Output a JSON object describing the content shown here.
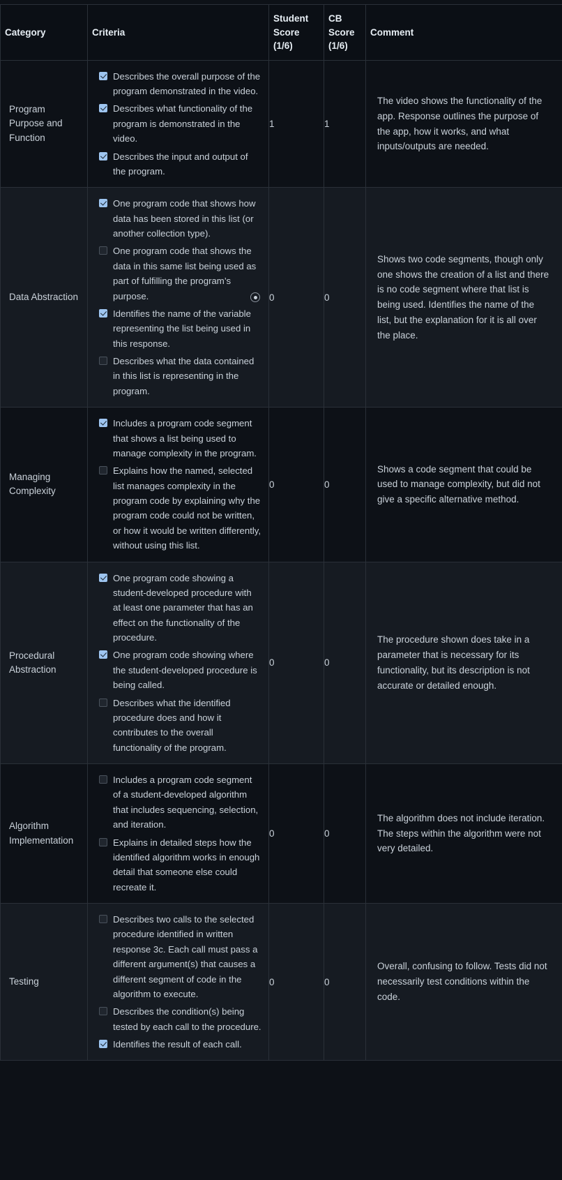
{
  "table": {
    "headers": {
      "category": "Category",
      "criteria": "Criteria",
      "student_score": "Student Score (1/6)",
      "student_score_line1": "Student",
      "student_score_line2": "Score",
      "student_score_line3": "(1/6)",
      "cb_score": "CB Score (1/6)",
      "cb_score_line1": "CB",
      "cb_score_line2": "Score",
      "cb_score_line3": "(1/6)",
      "comment": "Comment"
    },
    "rows": [
      {
        "category": "Program Purpose and Function",
        "criteria": [
          {
            "checked": true,
            "text": "Describes the overall purpose of the program demonstrated in the video."
          },
          {
            "checked": true,
            "text": "Describes what functionality of the program is demonstrated in the video."
          },
          {
            "checked": true,
            "text": "Describes the input and output of the program."
          }
        ],
        "student_score": "1",
        "cb_score": "1",
        "comment": "The video shows the functionality of the app. Response outlines the purpose of the app, how it works, and what inputs/outputs are needed.",
        "has_radio_marker": false
      },
      {
        "category": "Data Abstraction",
        "criteria": [
          {
            "checked": true,
            "text": "One program code that shows how data has been stored in this list (or another collection type)."
          },
          {
            "checked": false,
            "text": "One program code that shows the data in this same list being used as part of fulfilling the program’s purpose."
          },
          {
            "checked": true,
            "text": "Identifies the name of the variable representing the list being used in this response."
          },
          {
            "checked": false,
            "text": "Describes what the data contained in this list is representing in the program."
          }
        ],
        "student_score": "0",
        "cb_score": "0",
        "comment": "Shows two code segments, though only one shows the creation of a list and there is no code segment where that list is being used. Identifies the name of the list, but the explanation for it is all over the place.",
        "has_radio_marker": true
      },
      {
        "category": "Managing Complexity",
        "criteria": [
          {
            "checked": true,
            "text": "Includes a program code segment that shows a list being used to manage complexity in the program."
          },
          {
            "checked": false,
            "text": "Explains how the named, selected list manages complexity in the program code by explaining why the program code could not be written, or how it would be written differently, without using this list."
          }
        ],
        "student_score": "0",
        "cb_score": "0",
        "comment": "Shows a code segment that could be used to manage complexity, but did not give a specific alternative method.",
        "has_radio_marker": false
      },
      {
        "category": "Procedural Abstraction",
        "criteria": [
          {
            "checked": true,
            "text": "One program code showing a student-developed procedure with at least one parameter that has an effect on the functionality of the procedure."
          },
          {
            "checked": true,
            "text": "One program code showing where the student-developed procedure is being called."
          },
          {
            "checked": false,
            "text": "Describes what the identified procedure does and how it contributes to the overall functionality of the program."
          }
        ],
        "student_score": "0",
        "cb_score": "0",
        "comment": "The procedure shown does take in a parameter that is necessary for its functionality, but its description is not accurate or detailed enough.",
        "has_radio_marker": false
      },
      {
        "category": "Algorithm Implementation",
        "criteria": [
          {
            "checked": false,
            "text": "Includes a program code segment of a student-developed algorithm that includes sequencing, selection, and iteration."
          },
          {
            "checked": false,
            "text": "Explains in detailed steps how the identified algorithm works in enough detail that someone else could recreate it."
          }
        ],
        "student_score": "0",
        "cb_score": "0",
        "comment": "The algorithm does not include iteration. The steps within the algorithm were not very detailed.",
        "has_radio_marker": false
      },
      {
        "category": "Testing",
        "criteria": [
          {
            "checked": false,
            "text": "Describes two calls to the selected procedure identified in written response 3c. Each call must pass a different argument(s) that causes a different segment of code in the algorithm to execute."
          },
          {
            "checked": false,
            "text": "Describes the condition(s) being tested by each call to the procedure."
          },
          {
            "checked": true,
            "text": "Identifies the result of each call."
          }
        ],
        "student_score": "0",
        "cb_score": "0",
        "comment": "Overall, confusing to follow. Tests did not necessarily test conditions within the code.",
        "has_radio_marker": false
      }
    ]
  },
  "colors": {
    "background": "#0d1117",
    "row_alt": "#161b22",
    "border": "#2a3038",
    "text": "#c9d1d9",
    "checkbox_checked": "#9ec5f0"
  }
}
